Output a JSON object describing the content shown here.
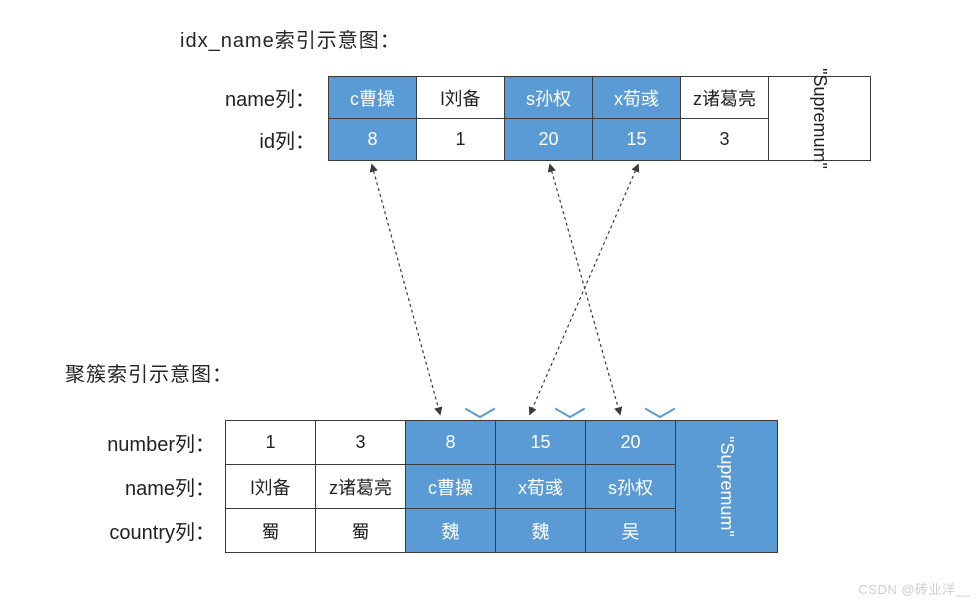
{
  "titles": {
    "secondary_index": "idx_name索引示意图：",
    "clustered_index": "聚簇索引示意图："
  },
  "secondary": {
    "row_labels": {
      "name": "name列：",
      "id": "id列："
    },
    "columns": [
      {
        "name": "c曹操",
        "id": "8",
        "highlight": true
      },
      {
        "name": "l刘备",
        "id": "1",
        "highlight": false
      },
      {
        "name": "s孙权",
        "id": "20",
        "highlight": true
      },
      {
        "name": "x荀彧",
        "id": "15",
        "highlight": true
      },
      {
        "name": "z诸葛亮",
        "id": "3",
        "highlight": false
      }
    ],
    "supremum": "\"Supremum\"",
    "supremum_highlight": false
  },
  "clustered": {
    "row_labels": {
      "number": "number列：",
      "name": "name列：",
      "country": "country列："
    },
    "columns": [
      {
        "number": "1",
        "name": "l刘备",
        "country": "蜀",
        "highlight": false
      },
      {
        "number": "3",
        "name": "z诸葛亮",
        "country": "蜀",
        "highlight": false
      },
      {
        "number": "8",
        "name": "c曹操",
        "country": "魏",
        "highlight": true
      },
      {
        "number": "15",
        "name": "x荀彧",
        "country": "魏",
        "highlight": true
      },
      {
        "number": "20",
        "name": "s孙权",
        "country": "吴",
        "highlight": true
      }
    ],
    "supremum": "\"Supremum\"",
    "supremum_highlight": true
  },
  "colors": {
    "accent": "#5B9BD5"
  },
  "watermark": "CSDN @砖业洋__"
}
